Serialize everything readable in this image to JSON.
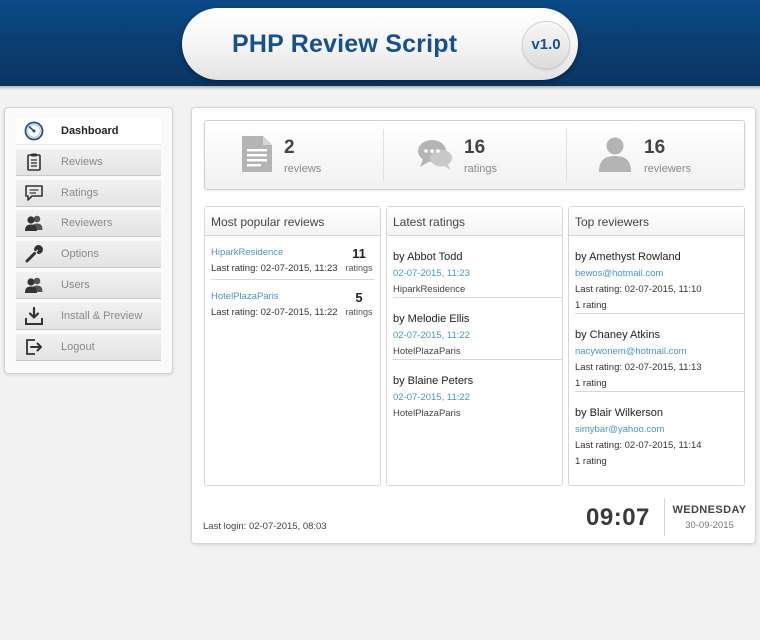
{
  "header": {
    "title": "PHP Review Script",
    "version": "v1.0"
  },
  "sidebar": {
    "items": [
      {
        "label": "Dashboard",
        "icon": "speedometer-icon",
        "active": true
      },
      {
        "label": "Reviews",
        "icon": "clipboard-icon"
      },
      {
        "label": "Ratings",
        "icon": "speech-bubble-icon"
      },
      {
        "label": "Reviewers",
        "icon": "users-icon"
      },
      {
        "label": "Options",
        "icon": "wrench-icon"
      },
      {
        "label": "Users",
        "icon": "users-icon"
      },
      {
        "label": "Install & Preview",
        "icon": "download-icon"
      },
      {
        "label": "Logout",
        "icon": "logout-icon"
      }
    ]
  },
  "stats": [
    {
      "value": "2",
      "label": "reviews",
      "icon": "document-icon"
    },
    {
      "value": "16",
      "label": "ratings",
      "icon": "chat-bubbles-icon"
    },
    {
      "value": "16",
      "label": "reviewers",
      "icon": "person-icon"
    }
  ],
  "popular": {
    "title": "Most popular reviews",
    "items": [
      {
        "name": "HiparkResidence",
        "last": "Last rating: 02-07-2015, 11:23",
        "count": "11",
        "count_label": "ratings"
      },
      {
        "name": "HotelPlazaParis",
        "last": "Last rating: 02-07-2015, 11:22",
        "count": "5",
        "count_label": "ratings"
      }
    ]
  },
  "latest": {
    "title": "Latest ratings",
    "items": [
      {
        "by": "by Abbot Todd",
        "date": "02-07-2015, 11:23",
        "place": "HiparkResidence"
      },
      {
        "by": "by Melodie Ellis",
        "date": "02-07-2015, 11:22",
        "place": "HotelPlazaParis"
      },
      {
        "by": "by Blaine Peters",
        "date": "02-07-2015, 11:22",
        "place": "HotelPlazaParis"
      }
    ]
  },
  "top": {
    "title": "Top reviewers",
    "items": [
      {
        "by": "by Amethyst Rowland",
        "email": "bewos@hotmail.com",
        "last": "Last rating: 02-07-2015, 11:10",
        "count": "1 rating"
      },
      {
        "by": "by Chaney Atkins",
        "email": "nacywonem@hotmail.com",
        "last": "Last rating: 02-07-2015, 11:13",
        "count": "1 rating"
      },
      {
        "by": "by Blair Wilkerson",
        "email": "simybar@yahoo.com",
        "last": "Last rating: 02-07-2015, 11:14",
        "count": "1 rating"
      }
    ]
  },
  "footer": {
    "last_login": "Last login: 02-07-2015, 08:03",
    "time": "09:07",
    "day": "WEDNESDAY",
    "date": "30-09-2015"
  },
  "colors": {
    "header": "#0b3d70",
    "brand_text": "#17508e",
    "link": "#4a96c8"
  }
}
